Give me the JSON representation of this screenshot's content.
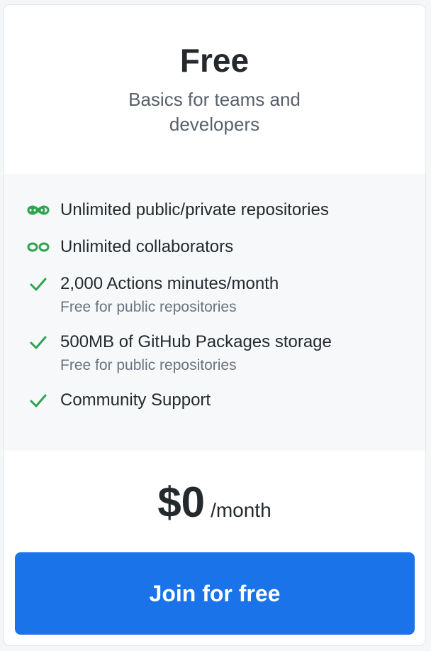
{
  "plan": {
    "title": "Free",
    "subtitle": "Basics for teams and developers"
  },
  "features": [
    {
      "icon": "infinity-icon",
      "label": "Unlimited public/private repositories",
      "note": ""
    },
    {
      "icon": "infinity-icon",
      "label": "Unlimited collaborators",
      "note": ""
    },
    {
      "icon": "check-icon",
      "label": "2,000 Actions minutes/month",
      "note": "Free for public repositories"
    },
    {
      "icon": "check-icon",
      "label": "500MB of GitHub Packages storage",
      "note": "Free for public repositories"
    },
    {
      "icon": "check-icon",
      "label": "Community Support",
      "note": ""
    }
  ],
  "pricing": {
    "amount": "$0",
    "period": "/month"
  },
  "cta": {
    "label": "Join for free"
  },
  "colors": {
    "accent": "#1a73e8",
    "icon_green": "#2ea44f",
    "feature_bg": "#f6f8fa"
  }
}
